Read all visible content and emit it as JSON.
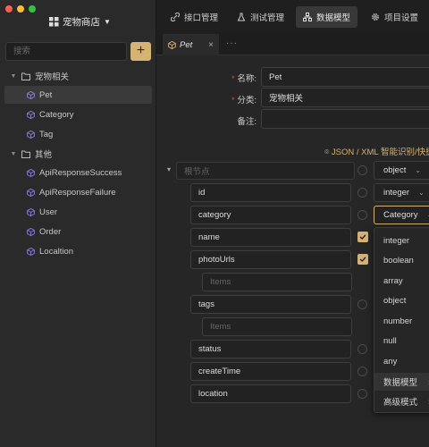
{
  "sidebar": {
    "project": "宠物商店",
    "search_placeholder": "搜索",
    "groups": [
      {
        "label": "宠物相关",
        "items": [
          "Pet",
          "Category",
          "Tag"
        ]
      },
      {
        "label": "其他",
        "items": [
          "ApiResponseSuccess",
          "ApiResponseFailure",
          "User",
          "Order",
          "Localtion"
        ]
      }
    ]
  },
  "topbar": {
    "tabs": [
      "接口管理",
      "测试管理",
      "数据模型",
      "项目设置"
    ]
  },
  "doc_tab": {
    "title": "Pet"
  },
  "form": {
    "name_label": "名称:",
    "name_value": "Pet",
    "category_label": "分类:",
    "category_value": "宠物相关",
    "note_label": "备注:",
    "json_hint": "JSON / XML 智能识别/快捷"
  },
  "schema": {
    "root": {
      "placeholder": "根节点",
      "type": "object"
    },
    "fields": [
      {
        "name": "id",
        "type": "integer",
        "required": false
      },
      {
        "name": "category",
        "type": "Category",
        "required": false
      },
      {
        "name": "name",
        "required": true
      },
      {
        "name": "photoUrls",
        "required": true
      },
      {
        "name": "Items",
        "placeholder": true
      },
      {
        "name": "tags",
        "required": false
      },
      {
        "name": "Items",
        "placeholder": true
      },
      {
        "name": "status",
        "required": false
      },
      {
        "name": "createTime",
        "required": false
      },
      {
        "name": "location",
        "required": false
      }
    ]
  },
  "type_menu": {
    "options": [
      "integer",
      "boolean",
      "array",
      "object",
      "number",
      "null",
      "any"
    ],
    "submenus": [
      "数据模型",
      "高级模式"
    ]
  },
  "colors": {
    "accent": "#d5b373",
    "window_close": "#ff5f57",
    "window_min": "#febc2e",
    "window_max": "#28c840"
  }
}
